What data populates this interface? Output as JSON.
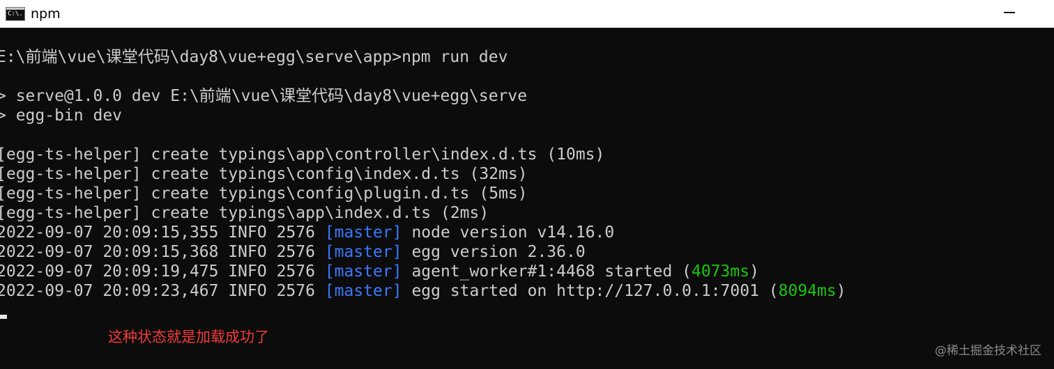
{
  "window": {
    "icon_text": "C:\\.",
    "title": "npm",
    "icon_name": "console-app-icon"
  },
  "console": {
    "lines": [
      "E:\\前端\\vue\\课堂代码\\day8\\vue+egg\\serve\\app>npm run dev",
      "> serve@1.0.0 dev E:\\前端\\vue\\课堂代码\\day8\\vue+egg\\serve",
      "> egg-bin dev",
      "[egg-ts-helper] create typings\\app\\controller\\index.d.ts (10ms)",
      "[egg-ts-helper] create typings\\config\\index.d.ts (32ms)",
      "[egg-ts-helper] create typings\\config\\plugin.d.ts (5ms)",
      "[egg-ts-helper] create typings\\app\\index.d.ts (2ms)"
    ],
    "logs": [
      {
        "prefix": "2022-09-07 20:09:15,355 INFO 2576 ",
        "tag": "[master]",
        "message": " node version v14.16.0",
        "time": "",
        "suffix": ""
      },
      {
        "prefix": "2022-09-07 20:09:15,368 INFO 2576 ",
        "tag": "[master]",
        "message": " egg version 2.36.0",
        "time": "",
        "suffix": ""
      },
      {
        "prefix": "2022-09-07 20:09:19,475 INFO 2576 ",
        "tag": "[master]",
        "message": " agent_worker#1:4468 started (",
        "time": "4073ms",
        "suffix": ")"
      },
      {
        "prefix": "2022-09-07 20:09:23,467 INFO 2576 ",
        "tag": "[master]",
        "message": " egg started on http://127.0.0.1:7001 (",
        "time": "8094ms",
        "suffix": ")"
      }
    ]
  },
  "annotation": "这种状态就是加载成功了",
  "watermark": "@稀土掘金技术社区",
  "colors": {
    "background": "#0c0c0c",
    "text": "#cccccc",
    "master_tag": "#3b78ff",
    "duration": "#16c60c",
    "annotation": "#f23a3a"
  }
}
